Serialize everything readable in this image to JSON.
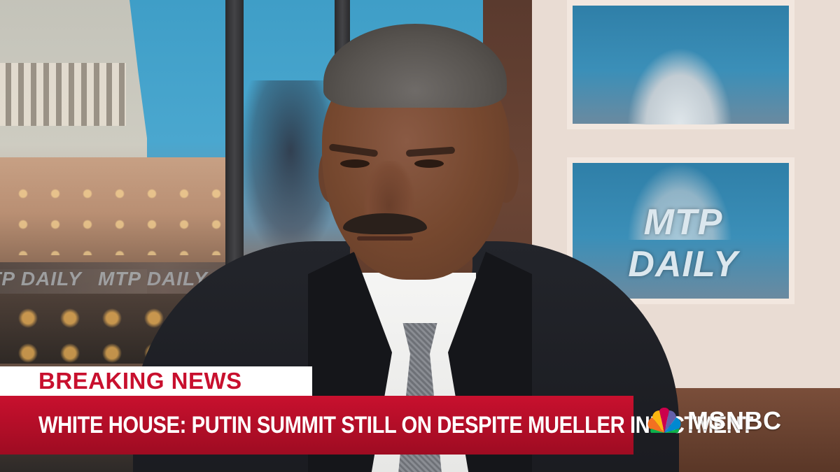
{
  "lower_third": {
    "banner_label": "BREAKING NEWS",
    "headline": "WHITE HOUSE: PUTIN SUMMIT STILL ON DESPITE MUELLER INDICTMENT",
    "colors": {
      "banner_red": "#c8102e",
      "banner_white": "#ffffff",
      "headline_text": "#ffffff"
    }
  },
  "network": {
    "logo_text": "MSNBC",
    "logo_icon": "peacock-icon"
  },
  "studio": {
    "monitor_logo": "MTP DAILY",
    "background_logo": "MTP DAILY"
  }
}
